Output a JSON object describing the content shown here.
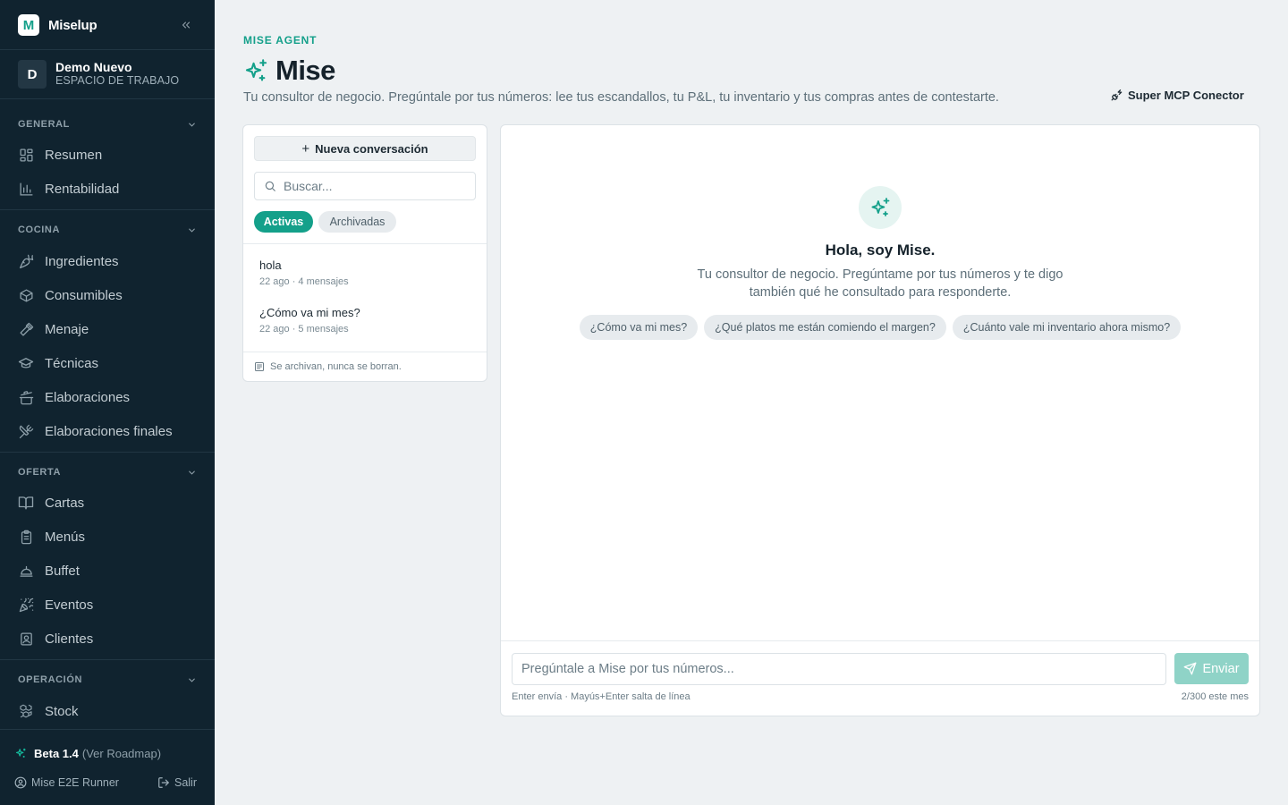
{
  "brand": {
    "logo_letter": "M",
    "name": "Miselup",
    "collapse_icon": "chevrons-left-icon"
  },
  "workspace": {
    "initial": "D",
    "name": "Demo Nuevo",
    "label": "ESPACIO DE TRABAJO"
  },
  "sections": [
    {
      "label": "GENERAL",
      "items": [
        {
          "label": "Resumen",
          "icon": "grid-icon"
        },
        {
          "label": "Rentabilidad",
          "icon": "bar-chart-icon"
        }
      ]
    },
    {
      "label": "COCINA",
      "items": [
        {
          "label": "Ingredientes",
          "icon": "carrot-icon"
        },
        {
          "label": "Consumibles",
          "icon": "box-icon"
        },
        {
          "label": "Menaje",
          "icon": "utensil-icon"
        },
        {
          "label": "Técnicas",
          "icon": "graduation-cap-icon"
        },
        {
          "label": "Elaboraciones",
          "icon": "cooking-pot-icon"
        },
        {
          "label": "Elaboraciones finales",
          "icon": "utensils-crossed-icon"
        }
      ]
    },
    {
      "label": "OFERTA",
      "items": [
        {
          "label": "Cartas",
          "icon": "book-open-icon"
        },
        {
          "label": "Menús",
          "icon": "clipboard-icon"
        },
        {
          "label": "Buffet",
          "icon": "cloche-icon"
        },
        {
          "label": "Eventos",
          "icon": "party-popper-icon"
        },
        {
          "label": "Clientes",
          "icon": "contact-icon"
        }
      ]
    },
    {
      "label": "OPERACIÓN",
      "items": [
        {
          "label": "Stock",
          "icon": "boxes-icon"
        }
      ]
    }
  ],
  "footer": {
    "version": "Beta 1.4",
    "roadmap": "(Ver Roadmap)",
    "user": "Mise E2E Runner",
    "logout": "Salir"
  },
  "header": {
    "eyebrow": "MISE AGENT",
    "title": "Mise",
    "subtitle": "Tu consultor de negocio. Pregúntale por tus números: lee tus escandallos, tu P&L, tu inventario y tus compras antes de contestarte.",
    "mcp_button": "Super MCP Conector"
  },
  "conversations": {
    "new_button": "Nueva conversación",
    "search_placeholder": "Buscar...",
    "tabs": {
      "active": "Activas",
      "archived": "Archivadas"
    },
    "items": [
      {
        "title": "hola",
        "meta": "22 ago · 4 mensajes"
      },
      {
        "title": "¿Cómo va mi mes?",
        "meta": "22 ago · 5 mensajes"
      }
    ],
    "note": "Se archivan, nunca se borran."
  },
  "chat": {
    "greeting": "Hola, soy Mise.",
    "intro": "Tu consultor de negocio. Pregúntame por tus números y te digo también qué he consultado para responderte.",
    "suggestions": [
      "¿Cómo va mi mes?",
      "¿Qué platos me están comiendo el margen?",
      "¿Cuánto vale mi inventario ahora mismo?"
    ],
    "input_placeholder": "Pregúntale a Mise por tus números...",
    "send_label": "Enviar",
    "hint": "Enter envía · Mayús+Enter salta de línea",
    "quota": "2/300 este mes"
  },
  "colors": {
    "accent": "#14a08a",
    "sidebar_bg": "#10232f",
    "page_bg": "#eef1f3",
    "send_disabled": "#8fd3c7"
  }
}
